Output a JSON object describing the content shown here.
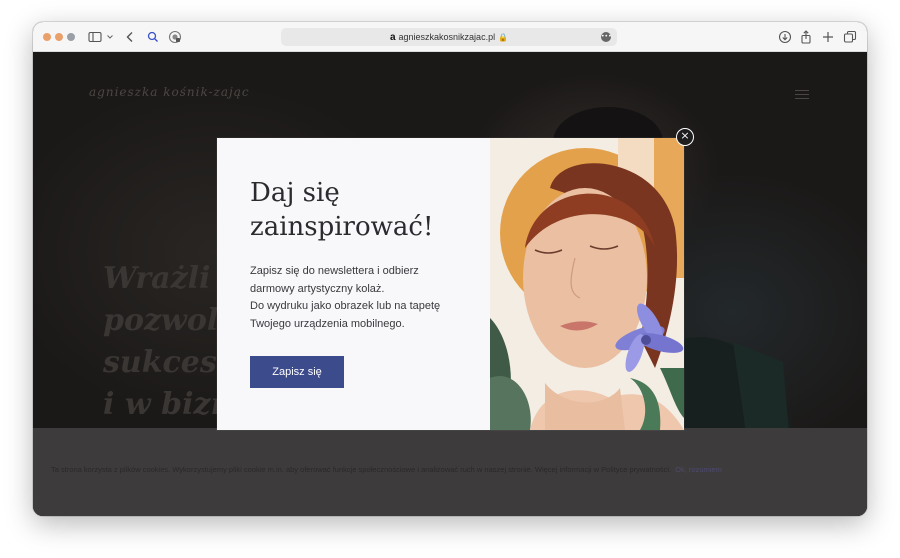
{
  "browser": {
    "url": "agnieszkakosnikzajac.pl",
    "site_glyph": "a",
    "lock_glyph": "🔒",
    "icons": {
      "sidebar": "sidebar-icon",
      "back": "back-icon",
      "search": "search-icon",
      "privacy": "privacy-icon",
      "download": "download-icon",
      "share": "share-icon",
      "new_tab": "plus-icon",
      "tabs": "tabs-overview-icon"
    }
  },
  "site": {
    "logo": "agnieszka kośnik-zając",
    "hero_heading": "Wrażli\npozwol\nsukces\ni w bizn",
    "colors": {
      "accent": "#3c4b8c",
      "background": "#1b1918"
    }
  },
  "modal": {
    "title": "Daj się\nzainspirować!",
    "body_lines": [
      "Zapisz się do newslettera i odbierz",
      "darmowy artystyczny kolaż.",
      "Do wydruku jako obrazek lub na tapetę",
      "Twojego urządzenia mobilnego."
    ],
    "button_label": "Zapisz się",
    "close_label": "×"
  },
  "cookie": {
    "text": "Ta strona korzysta z plików cookies. Wykorzystujemy pliki cookie m.in. aby oferować funkcje społecznościowe i analizować ruch w naszej stronie. Więcej informacji w Polityce prywatności.",
    "ok_label": "Ok, rozumiem"
  }
}
